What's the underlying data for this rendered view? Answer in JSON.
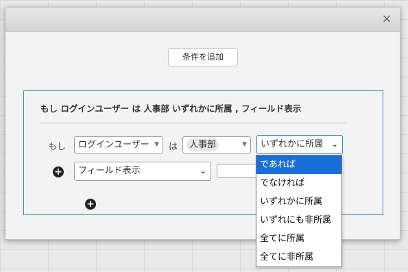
{
  "dialog": {
    "close_label": "×",
    "add_condition_label": "条件を追加"
  },
  "condition": {
    "summary": "もし ログインユーザー は 人事部 いずれかに所属 , フィールド表示",
    "if_label": "もし",
    "field_value": "ログインユーザー",
    "is_label": "は",
    "dept_value": "人事部",
    "operator_value": "いずれかに所属",
    "action_value": "フィールド表示",
    "action_text_value": ""
  },
  "operator_options": [
    "であれば",
    "でなければ",
    "いずれかに所属",
    "いずれにも非所属",
    "全てに所属",
    "全てに非所属"
  ],
  "selected_option_index": 0,
  "icons": {
    "plus": "+",
    "caret": "▼",
    "chevron": "⌄"
  },
  "colors": {
    "panel_border": "#2a8ba6",
    "option_highlight": "#1a6fd6"
  }
}
